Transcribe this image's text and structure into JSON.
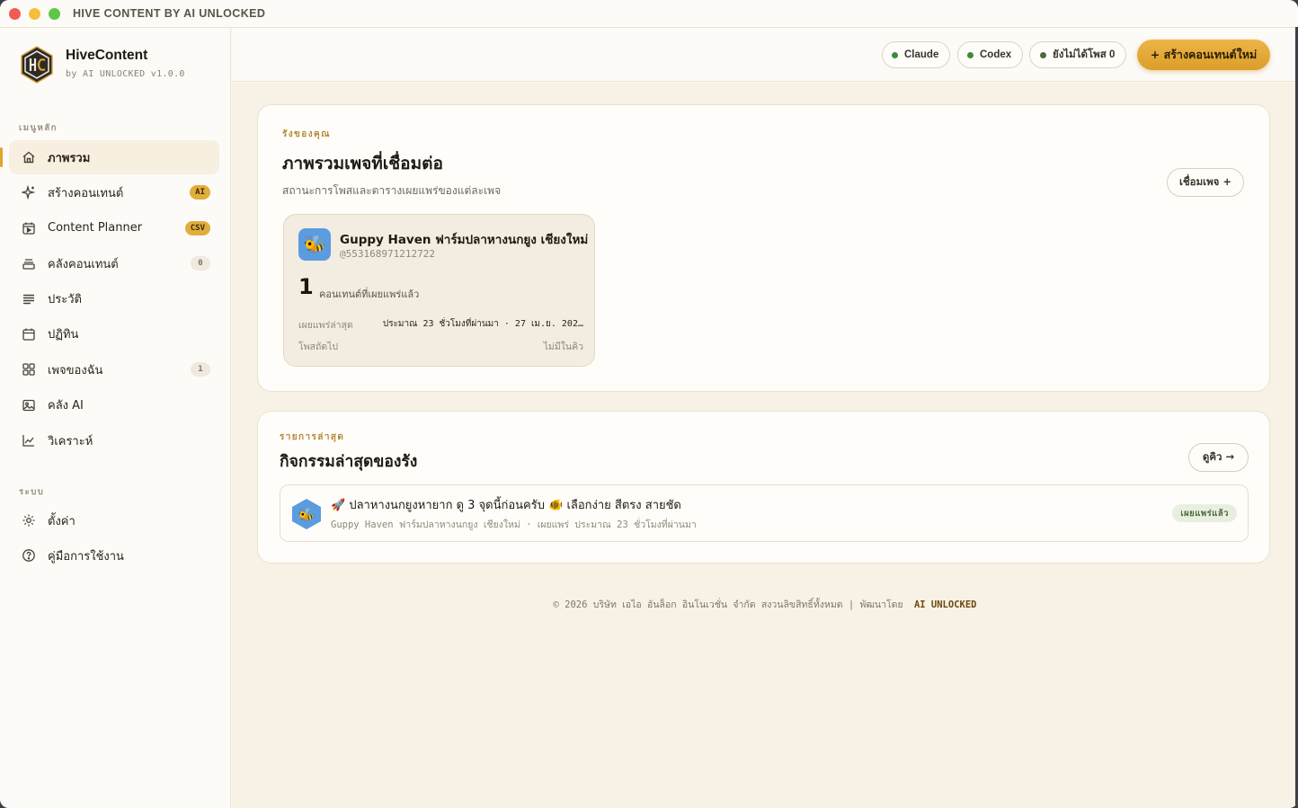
{
  "window": {
    "title": "HIVE CONTENT BY AI UNLOCKED"
  },
  "brand": {
    "name": "HiveContent",
    "subtitle": "by AI UNLOCKED v1.0.0"
  },
  "sidebar": {
    "main_label": "เมนูหลัก",
    "items": [
      {
        "label": "ภาพรวม",
        "icon": "home-icon",
        "active": true,
        "badge": ""
      },
      {
        "label": "สร้างคอนเทนต์",
        "icon": "sparkle-icon",
        "badge": "AI"
      },
      {
        "label": "Content Planner",
        "icon": "calendar-play-icon",
        "badge": "CSV"
      },
      {
        "label": "คลังคอนเทนต์",
        "icon": "stack-icon",
        "badge": "0"
      },
      {
        "label": "ประวัติ",
        "icon": "list-icon",
        "badge": ""
      },
      {
        "label": "ปฏิทิน",
        "icon": "calendar-icon",
        "badge": ""
      },
      {
        "label": "เพจของฉัน",
        "icon": "grid-icon",
        "badge": "1"
      },
      {
        "label": "คลัง AI",
        "icon": "image-icon",
        "badge": ""
      },
      {
        "label": "วิเคราะห์",
        "icon": "chart-icon",
        "badge": ""
      }
    ],
    "system_label": "ระบบ",
    "system_items": [
      {
        "label": "ตั้งค่า",
        "icon": "gear-icon"
      },
      {
        "label": "คู่มือการใช้งาน",
        "icon": "help-icon"
      }
    ]
  },
  "topbar": {
    "pill_claude": "Claude",
    "pill_codex": "Codex",
    "pill_unposted": "ยังไม่ได้โพส 0",
    "cta_label": "+ สร้างคอนเทนต์ใหม่"
  },
  "overview": {
    "eyebrow": "รังของคุณ",
    "title": "ภาพรวมเพจที่เชื่อมต่อ",
    "subtitle": "สถานะการโพสและตารางเผยแพร่ของแต่ละเพจ",
    "connect_button": "เชื่อมเพจ +",
    "page": {
      "name": "Guppy Haven ฟาร์มปลาหางนกยูง เชียงใหม่",
      "handle": "@553168971212722",
      "count": "1",
      "count_label": "คอนเทนต์ที่เผยแพร่แล้ว",
      "last_published_label": "เผยแพร่ล่าสุด",
      "last_published_value": "ประมาณ 23 ชั่วโมงที่ผ่านมา · 27 เม.ย. 202…",
      "next_post_label": "โพสถัดไป",
      "next_post_value": "ไม่มีในคิว"
    }
  },
  "activity": {
    "eyebrow": "รายการล่าสุด",
    "title": "กิจกรรมล่าสุดของรัง",
    "queue_button": "ดูคิว →",
    "item": {
      "title": "🚀 ปลาหางนกยูงหายาก ดู 3 จุดนี้ก่อนครับ 🐠 เลือกง่าย สีตรง สายชัด",
      "meta": "Guppy Haven ฟาร์มปลาหางนกยูง เชียงใหม่ · เผยแพร่ ประมาณ 23 ชั่วโมงที่ผ่านมา",
      "status": "เผยแพร่แล้ว"
    }
  },
  "footer": {
    "text": "© 2026 บริษัท เอไอ อันล็อก อินโนเวชั่น จำกัด สงวนลิขสิทธิ์ทั้งหมด | พัฒนาโดย",
    "brand": "AI UNLOCKED"
  },
  "colors": {
    "accent": "#e0a52b",
    "background": "#f8f2e6",
    "status_green": "#3f8a3a"
  }
}
